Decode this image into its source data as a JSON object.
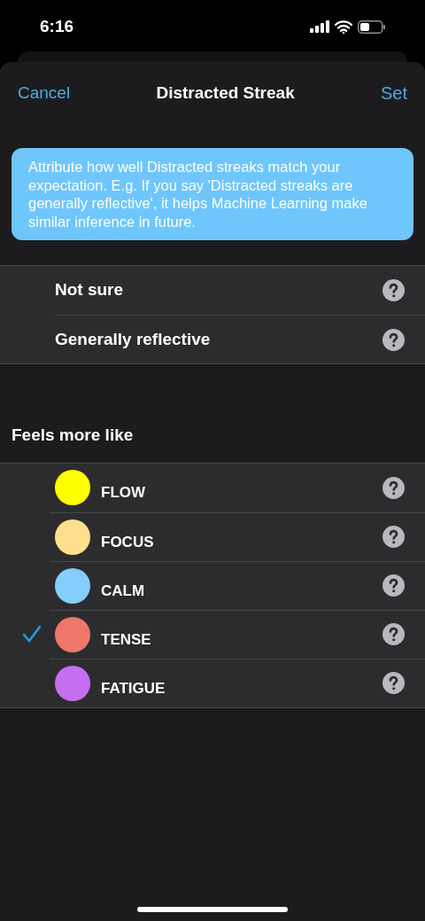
{
  "status_bar": {
    "time": "6:16"
  },
  "nav": {
    "cancel": "Cancel",
    "title": "Distracted Streak",
    "confirm": "Set"
  },
  "info": "Attribute how well Distracted streaks match your expectation. E.g. If you say 'Distracted streaks are generally reflective', it helps Machine Learning make similar inference in future.",
  "options": [
    {
      "label": "Not sure",
      "selected": false
    },
    {
      "label": "Generally reflective",
      "selected": false
    }
  ],
  "feels_section": {
    "header": "Feels more like",
    "items": [
      {
        "label": "FLOW",
        "color": "#ffff00",
        "selected": false
      },
      {
        "label": "FOCUS",
        "color": "#fddf8d",
        "selected": false
      },
      {
        "label": "CALM",
        "color": "#84cefc",
        "selected": false
      },
      {
        "label": "TENSE",
        "color": "#ee776b",
        "selected": true
      },
      {
        "label": "FATIGUE",
        "color": "#c66ff0",
        "selected": false
      }
    ]
  }
}
